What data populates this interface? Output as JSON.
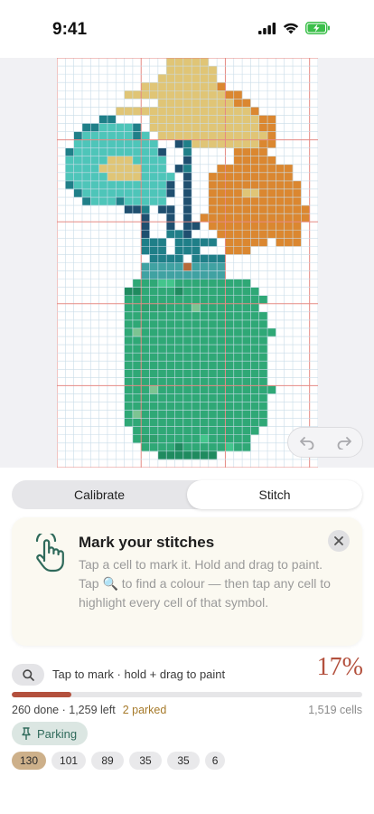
{
  "status_bar": {
    "time": "9:41",
    "icons": [
      "cellular-signal-icon",
      "wifi-icon",
      "battery-charging-icon"
    ]
  },
  "pattern": {
    "cols": 31,
    "rows": 50,
    "colors": {
      "b": "#e0c576",
      "o": "#db8730",
      "t": "#4ec5b9",
      "n": "#1f4f6f",
      "k": "#1f7f88",
      "g": "#2fa876",
      "d": "#1f8b5f",
      "l": "#43c58c",
      "m": "#2ea06e",
      "s": "#7cc492",
      "y": "#e0c576",
      "w": "#b56a3a",
      "q": "#40a2a2"
    },
    "rows_map": [
      ".............bbbbb.............",
      ".............bbbbbb............",
      "............bbbbbbb............",
      "..........bbbbbbbbbo...........",
      "........bbbbbbbbbbbboo.........",
      "............bbbbbbbbboo........",
      ".......bbbbbbbbbbbbbbbbo.......",
      ".....kk....bbbbbbbbbbbbboo.....",
      "...kkttttk.bbbbbbbbbbbbboo.....",
      "..kttttttkt.bbbbbbbbbbbbbo.....",
      "..tttttttttt..nkbbbbbbbboo.....",
      ".kttttttttttn..k.....oooo......",
      ".tttttyyytttt..n.....ooooo.....",
      ".ttttyyyyyttt.nk...ooooooooo...",
      ".tttttyyyytttt.n..oooooooooo...",
      ".ktttttttttttn.n..ooooooooooo..",
      "..kttttttttttn.n..ooooyyooooo..",
      "...ktttkttttt..n..ooooooooooo..",
      "........nnk.nn.n..oooooooooooo.",
      "..........n..n.n.ooooooooooooo.",
      "..........n..n.nn.ooooooooooo..",
      "..........n..kkn...oooooooooo..",
      "..........kkk.kkkkk.ooooo.ooo..",
      "..........kkk.kkk...ooo........",
      "...........kkkk.kkkk...........",
      "..........qqqqqwqqqq...........",
      "..........qqqqqqqqqq...........",
      ".........gggllggggggggg........",
      "........ddggggdggggggggg.......",
      "........ggggggggggggggggg......",
      "........ggmmmgggsggggggg.......",
      "........ggggggggggggggggg......",
      "........ggggggggggggggggg......",
      "........gsgggggggggggggggg.....",
      "........ggggggggggggggggg......",
      "........ggggggggggggggggg......",
      "........ggggggggggggggggg......",
      "........ggggggggggggggggg......",
      "........ggggggggggggggggg......",
      "........ggggggggggggggggg......",
      "........gggsgggggggggggggg.....",
      "........ggggggggggggggggg......",
      "........ggggggggggggggggg......",
      "........gsggggggggggggggg......",
      "........ggggggggggggggggg......",
      ".........ggggggggggggggg.......",
      ".........gmmggggglggggg........",
      "..........ggggdggggglgg........",
      "............ddddddd............",
      "..............................."
    ]
  },
  "tabs": {
    "calibrate": "Calibrate",
    "stitch": "Stitch"
  },
  "tip": {
    "title": "Mark your stitches",
    "body": "Tap a cell to mark it. Hold and drag to paint. Tap 🔍 to find a colour — then tap any cell to highlight every cell of that symbol."
  },
  "progress": {
    "hint": "Tap to mark · hold + drag to paint",
    "percent": "17%",
    "fraction": 0.17,
    "done": "260 done",
    "left": "1,259 left",
    "parked": "2 parked",
    "total": "1,519 cells"
  },
  "parking": {
    "label": "Parking"
  },
  "color_counts": [
    "130",
    "101",
    "89",
    "35",
    "35",
    "6"
  ],
  "theme": {
    "accent": "#b3503d",
    "teal": "#2f6a5b"
  }
}
